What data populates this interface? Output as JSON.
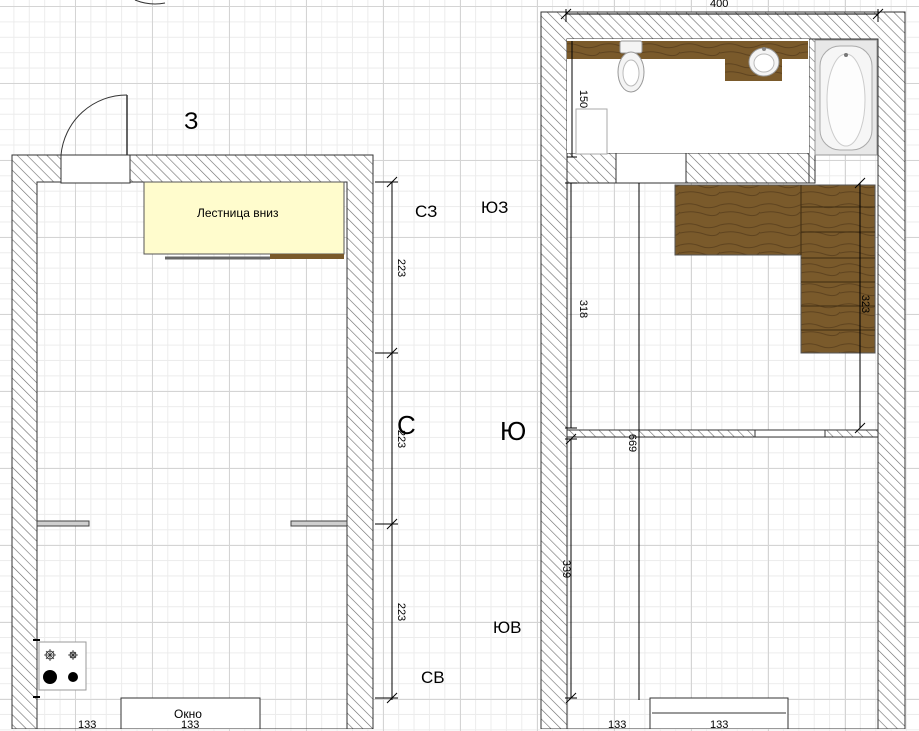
{
  "top_dimension": "400",
  "compass": {
    "west": "З",
    "north": "С",
    "south": "Ю",
    "northwest": "СЗ",
    "southwest": "ЮЗ",
    "southeast": "ЮВ",
    "northeast": "СВ"
  },
  "left_floor": {
    "stair_label": "Лестница вниз",
    "window_label": "Окно",
    "dims": [
      "223",
      "223",
      "223",
      "133",
      "133"
    ]
  },
  "right_floor": {
    "dims": [
      "150",
      "318",
      "323",
      "669",
      "339",
      "133",
      "133"
    ]
  }
}
